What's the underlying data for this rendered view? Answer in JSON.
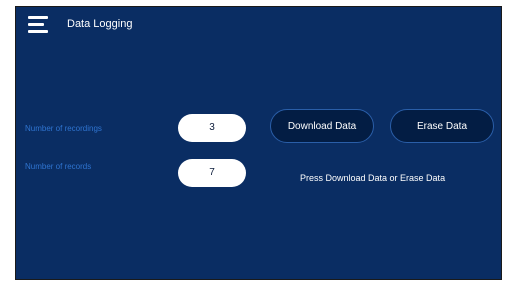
{
  "header": {
    "menu_icon": "hamburger-menu-icon",
    "title": "Data Logging"
  },
  "fields": {
    "recordings_label": "Number of recordings",
    "recordings_value": "3",
    "records_label": "Number of records",
    "records_value": "7"
  },
  "actions": {
    "download_label": "Download Data",
    "erase_label": "Erase Data"
  },
  "status": {
    "message": "Press Download Data or Erase Data"
  },
  "colors": {
    "background": "#0a2d63",
    "button_fill": "#031d44",
    "label_blue": "#2f74d0"
  }
}
